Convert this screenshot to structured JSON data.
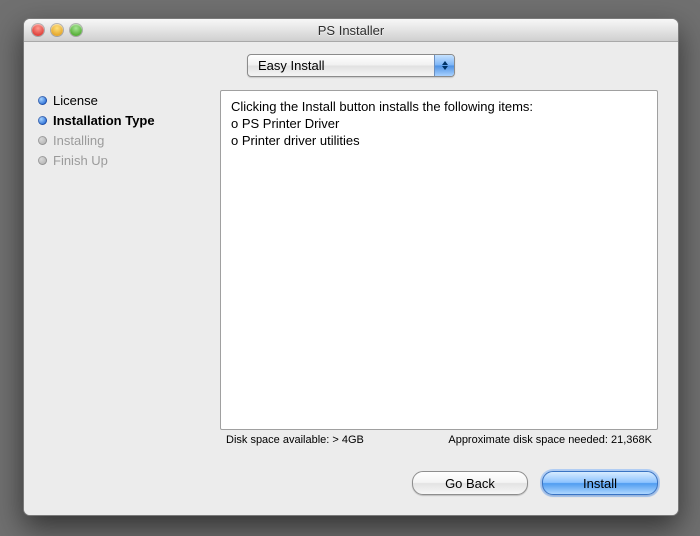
{
  "window": {
    "title": "PS Installer"
  },
  "dropdown": {
    "selected": "Easy Install"
  },
  "sidebar": {
    "items": [
      {
        "label": "License",
        "state": "completed"
      },
      {
        "label": "Installation Type",
        "state": "active"
      },
      {
        "label": "Installing",
        "state": "pending"
      },
      {
        "label": "Finish Up",
        "state": "pending"
      }
    ]
  },
  "content": {
    "intro": "Clicking the Install button installs the following items:",
    "items": [
      "PS Printer Driver",
      "Printer driver utilities"
    ]
  },
  "disk": {
    "available": "Disk space available: > 4GB",
    "needed": "Approximate disk space needed: 21,368K"
  },
  "buttons": {
    "go_back": "Go Back",
    "install": "Install"
  }
}
